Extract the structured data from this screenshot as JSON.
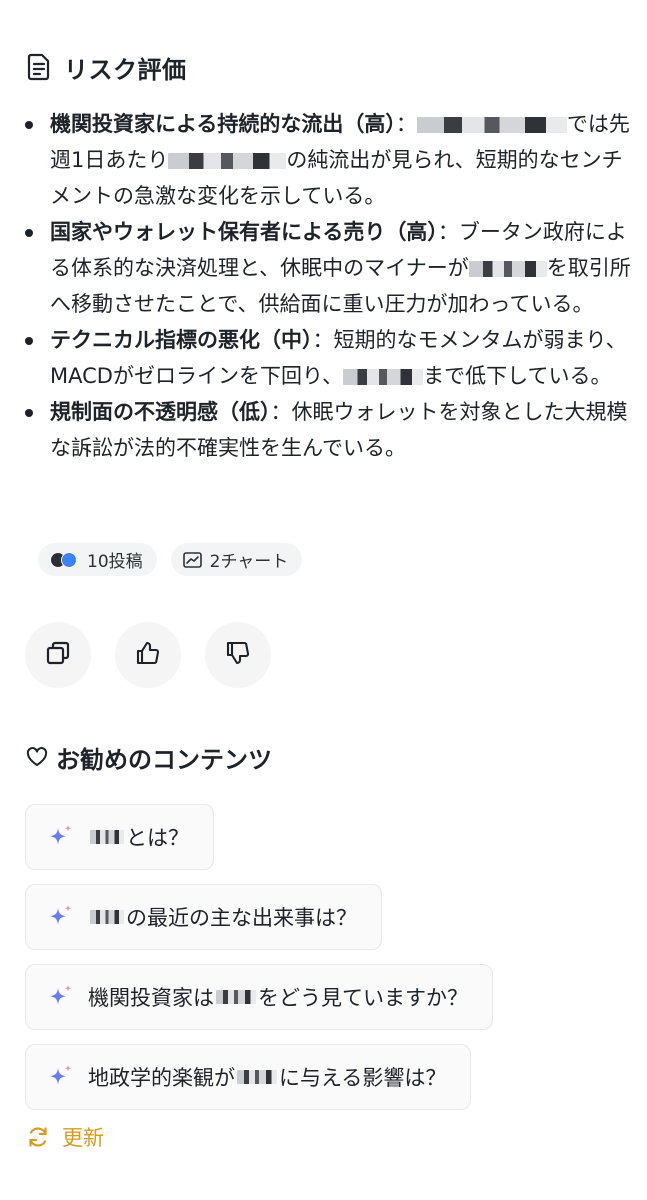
{
  "risk_section": {
    "title": "リスク評価",
    "icon": "document-icon",
    "items": [
      {
        "head": "機関投資家による持続的な流出（高）",
        "p1": "：",
        "p2": "では先週1日あたり",
        "p3": "の純流出が見られ、短期的なセンチメントの急激な変化を示している。"
      },
      {
        "head": "国家やウォレット保有者による売り（高）",
        "p1": "：ブータン政府による体系的な決済処理と、休眠中のマイナーが",
        "p2": "を取引所へ移動させたことで、供給面に重い圧力が加わっている。"
      },
      {
        "head": "テクニカル指標の悪化（中）",
        "p1": "：短期的なモメンタムが弱まり、MACDがゼロラインを下回り、",
        "p2": "まで低下している。"
      },
      {
        "head": "規制面の不透明感（低）",
        "p1": "：休眠ウォレットを対象とした大規模な訴訟が法的不確実性を生んでいる。"
      }
    ]
  },
  "chips": {
    "posts_label": "10投稿",
    "charts_label": "2チャート"
  },
  "actions": {
    "copy_icon": "copy-icon",
    "like_icon": "thumbs-up-icon",
    "dislike_icon": "thumbs-down-icon"
  },
  "recommendations": {
    "title": "お勧めのコンテンツ",
    "icon": "heart-icon",
    "items": [
      {
        "before": "",
        "after": "とは？"
      },
      {
        "before": "",
        "after": "の最近の主な出来事は？"
      },
      {
        "before": "機関投資家は",
        "after": "をどう見ていますか？"
      },
      {
        "before": "地政学的楽観が",
        "after": "に与える影響は？"
      }
    ],
    "refresh_label": "更新"
  },
  "colors": {
    "text": "#1e2329",
    "accent_refresh": "#d89b1e",
    "chip_bg": "#f3f4f6",
    "button_bg": "#f5f5f5"
  }
}
